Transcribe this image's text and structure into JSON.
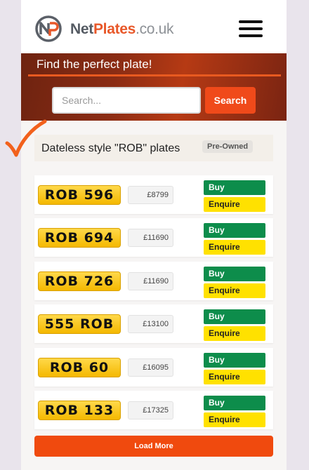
{
  "brand": {
    "name_part1": "Net",
    "name_part2": "Plates",
    "tld": ".co.uk",
    "logo_icon": "np-circle-logo",
    "accent_color": "#f04a1a"
  },
  "header": {
    "menu_icon": "hamburger-menu-icon"
  },
  "hero": {
    "title": "Find the perfect plate!",
    "search_placeholder": "Search...",
    "search_button": "Search"
  },
  "section": {
    "title": "Dateless style \"ROB\" plates",
    "badge": "Pre-Owned"
  },
  "listings": [
    {
      "plate": "ROB 596",
      "price": "£8799",
      "buy": "Buy",
      "enquire": "Enquire"
    },
    {
      "plate": "ROB 694",
      "price": "£11690",
      "buy": "Buy",
      "enquire": "Enquire"
    },
    {
      "plate": "ROB 726",
      "price": "£11690",
      "buy": "Buy",
      "enquire": "Enquire"
    },
    {
      "plate": "555 ROB",
      "price": "£13100",
      "buy": "Buy",
      "enquire": "Enquire"
    },
    {
      "plate": "ROB 60",
      "price": "£16095",
      "buy": "Buy",
      "enquire": "Enquire"
    },
    {
      "plate": "ROB 133",
      "price": "£17325",
      "buy": "Buy",
      "enquire": "Enquire"
    }
  ],
  "load_more": "Load More",
  "annotation": {
    "icon": "orange-checkmark-icon"
  }
}
